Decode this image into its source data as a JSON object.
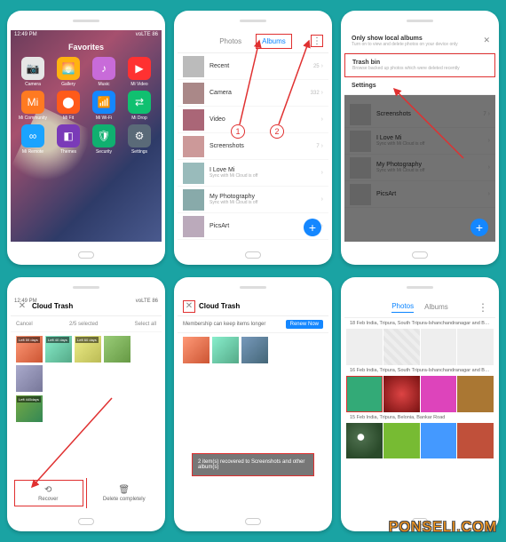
{
  "watermark": "PONSELI.COM",
  "statusbar": {
    "time": "12:49 PM",
    "right": "voLTE 86"
  },
  "screen1": {
    "title": "Favorites",
    "apps": [
      {
        "name": "Camera",
        "color": "#e6e6e6",
        "glyph": "📷"
      },
      {
        "name": "Gallery",
        "color": "#ffb310",
        "glyph": "🌅"
      },
      {
        "name": "Music",
        "color": "#c86bd9",
        "glyph": "♪"
      },
      {
        "name": "Mi Video",
        "color": "#ff3131",
        "glyph": "▶"
      },
      {
        "name": "Mi Community",
        "color": "#ff7a21",
        "glyph": "Mi"
      },
      {
        "name": "Mi Fit",
        "color": "#ff5a1a",
        "glyph": "⬤"
      },
      {
        "name": "Mi Wi-Fi",
        "color": "#1487ff",
        "glyph": "📶"
      },
      {
        "name": "Mi Drop",
        "color": "#10c070",
        "glyph": "⇄"
      },
      {
        "name": "Mi Remote",
        "color": "#1aa3ff",
        "glyph": "∞"
      },
      {
        "name": "Themes",
        "color": "#7a3ab8",
        "glyph": "◧"
      },
      {
        "name": "Security",
        "color": "#10b070",
        "glyph": "🛡"
      },
      {
        "name": "Settings",
        "color": "#5a6a78",
        "glyph": "⚙"
      }
    ]
  },
  "screen2": {
    "tabs": {
      "photos": "Photos",
      "albums": "Albums"
    },
    "albums": [
      {
        "name": "Recent",
        "sub": "",
        "count": "25"
      },
      {
        "name": "Camera",
        "sub": "",
        "count": "332"
      },
      {
        "name": "Video",
        "sub": "",
        "count": ""
      },
      {
        "name": "Screenshots",
        "sub": "",
        "count": "7"
      },
      {
        "name": "I Love Mi",
        "sub": "Sync with Mi Cloud is off",
        "count": ""
      },
      {
        "name": "My Photography",
        "sub": "Sync with Mi Cloud is off",
        "count": ""
      },
      {
        "name": "PicsArt",
        "sub": "",
        "count": ""
      }
    ],
    "markers": {
      "one": "1",
      "two": "2"
    }
  },
  "screen3": {
    "menu": [
      {
        "title": "Only show local albums",
        "sub": "Turn on to view and delete photos on your device only",
        "hi": false
      },
      {
        "title": "Trash bin",
        "sub": "Browse backed up photos which were deleted recently",
        "hi": true
      },
      {
        "title": "Settings",
        "sub": "",
        "hi": false
      }
    ],
    "bg": [
      {
        "name": "Screenshots",
        "count": "7"
      },
      {
        "name": "I Love Mi",
        "sub": "Sync with Mi Cloud is off"
      },
      {
        "name": "My Photography",
        "sub": "Sync with Mi Cloud is off"
      },
      {
        "name": "PicsArt"
      }
    ]
  },
  "screen4": {
    "title": "Cloud Trash",
    "cancel": "Cancel",
    "status": "2/5 selected",
    "selectAll": "Select all",
    "thumbs": [
      "Left 59 days",
      "Left 40 days",
      "Left 60 days",
      "",
      "",
      ""
    ],
    "extra": "Left 445days",
    "recover": "Recover",
    "delete": "Delete completely"
  },
  "screen5": {
    "title": "Cloud Trash",
    "member": "Membership can keep items longer",
    "renew": "Renew Now",
    "toast": "2 item(s) recovered to Screenshots and other album(s)"
  },
  "screen6": {
    "tabs": {
      "photos": "Photos",
      "albums": "Albums"
    },
    "sections": [
      "18 Feb  India, Tripura, South Tripura-Ishanchandranagar and Bel…",
      "16 Feb  India, Tripura, South Tripura-Ishanchandranagar and Bel…",
      "15 Feb  India, Tripura, Belonia, Bankar Road"
    ]
  }
}
